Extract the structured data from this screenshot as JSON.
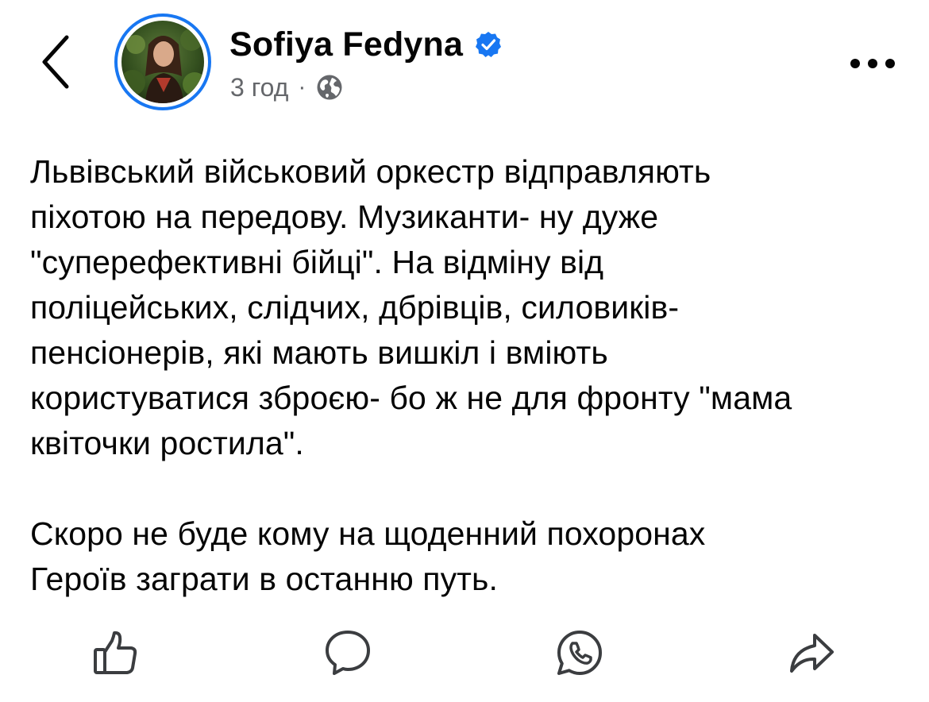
{
  "header": {
    "author_name": "Sofiya Fedyna",
    "timestamp": "3 год",
    "separator": "·",
    "audience_icon": "globe-icon",
    "verified_icon": "verified-badge-icon",
    "back_icon": "chevron-left-icon",
    "more_icon": "more-horizontal-icon"
  },
  "post": {
    "paragraph_1": "Львівський військовий оркестр відправляють\nпіхотою на передову. Музиканти- ну дуже\n\"суперефективні бійці\". На відміну від\nполіцейських, слідчих, дбрівців, силовиків-\nпенсіонерів, які мають вишкіл і вміють\nкористуватися зброєю- бо ж не для фронту \"мама\nквіточки ростила\".",
    "paragraph_2": "Скоро не буде кому на щоденний похоронах\nГероїв заграти в останню путь."
  },
  "actions": [
    {
      "name": "like",
      "icon": "thumbs-up-icon"
    },
    {
      "name": "comment",
      "icon": "comment-bubble-icon"
    },
    {
      "name": "whatsapp",
      "icon": "whatsapp-icon"
    },
    {
      "name": "share",
      "icon": "share-arrow-icon"
    }
  ],
  "colors": {
    "accent": "#1877f2",
    "text": "#050505",
    "secondary_text": "#65676b"
  }
}
